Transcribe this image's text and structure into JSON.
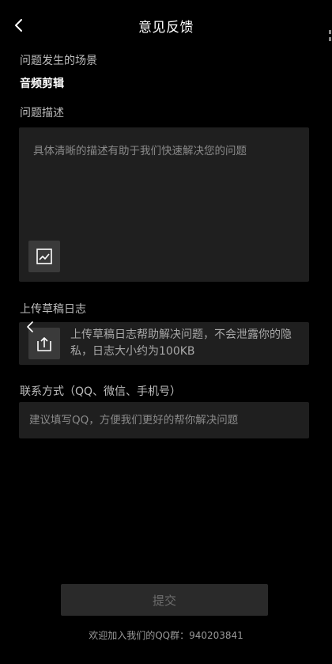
{
  "header": {
    "title": "意见反馈",
    "back_icon": "chevron-left-icon"
  },
  "scene": {
    "label": "问题发生的场景",
    "value": "音频剪辑"
  },
  "description": {
    "label": "问题描述",
    "placeholder": "具体清晰的描述有助于我们快速解决您的问题",
    "image_icon": "image-icon"
  },
  "upload_log": {
    "label": "上传草稿日志",
    "text": "上传草稿日志帮助解决问题，不会泄露你的隐私，日志大小约为100KB",
    "icon": "upload-icon"
  },
  "contact": {
    "label": "联系方式（QQ、微信、手机号）",
    "placeholder": "建议填写QQ，方便我们更好的帮你解决问题"
  },
  "submit": {
    "label": "提交"
  },
  "footer": {
    "text": "欢迎加入我们的QQ群：940203841"
  },
  "colors": {
    "background": "#000000",
    "panel": "#1f1f1f",
    "icon_tile": "#3a3a3a",
    "button_disabled": "#2a2a2a",
    "placeholder": "#8a8a8a"
  }
}
